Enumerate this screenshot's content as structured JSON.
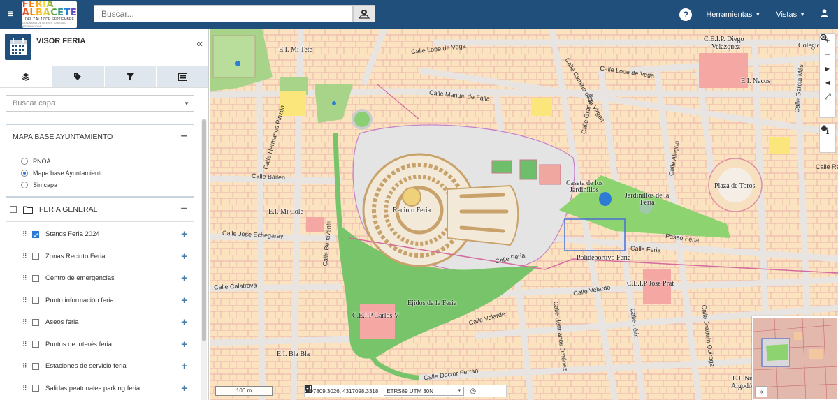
{
  "topbar": {
    "logo_title": "FERIA ALBACETE",
    "logo_dates": "DEL 7 AL 17 DE SEPTIEMBRE",
    "logo_tagline": "DECLARADA DE INTERÉS TURÍSTICO INTERNACIONAL",
    "search_placeholder": "Buscar...",
    "menu_tools": "Herramientas",
    "menu_views": "Vistas"
  },
  "sidebar": {
    "title": "VISOR FERIA",
    "capa_placeholder": "Buscar capa",
    "base_section": {
      "title": "MAPA BASE AYUNTAMIENTO",
      "options": [
        {
          "label": "PNOA",
          "selected": false
        },
        {
          "label": "Mapa base Ayuntamiento",
          "selected": true
        },
        {
          "label": "Sin capa",
          "selected": false
        }
      ]
    },
    "feria_section": {
      "title": "FERIA GENERAL",
      "layers": [
        {
          "label": "Stands Feria 2024",
          "checked": true
        },
        {
          "label": "Zonas Recinto Feria",
          "checked": false
        },
        {
          "label": "Centro de emergencias",
          "checked": false
        },
        {
          "label": "Punto información feria",
          "checked": false
        },
        {
          "label": "Aseos feria",
          "checked": false
        },
        {
          "label": "Puntos de interés feria",
          "checked": false
        },
        {
          "label": "Estaciones de servicio feria",
          "checked": false
        },
        {
          "label": "Salidas peatonales parking feria",
          "checked": false
        }
      ]
    }
  },
  "map": {
    "labels": {
      "mitete": "E.I. Mi Tete",
      "diego": "C.E.I.P. Diego",
      "velazquez": "Velazquez",
      "nacos": "E.I. Nacos",
      "micole": "E.I. Mi Cole",
      "recinto": "Recinto Feria",
      "caseta1": "Caseta de los",
      "caseta2": "Jardinillos",
      "jard1": "Jardinillos de la",
      "jard2": "Feria",
      "toros": "Plaza de Toros",
      "polideportivo": "Polideportivo Feria",
      "prat": "C.E.I.P Jose Prat",
      "ejidos": "Ejidos de la Feria",
      "carlos": "C.E.I.P Carlos V",
      "blabla": "E.I. Bla Bla",
      "nube": "E.I. Nube",
      "algodon": "Algodó",
      "colegio": "Colegio"
    },
    "streets": {
      "lope1": "Calle Lope de Vega",
      "lope2": "Calle Lope de Vega",
      "manuel": "Calle Manuel de Falla",
      "bailen": "Calle Bailén",
      "echegaray": "Calle José Echegaray",
      "calatrava": "Calle Calatrava",
      "feria1": "Calle Feria",
      "feria2": "Calle Feria",
      "paseo": "Paseo Feria",
      "velarde1": "Calle Velarde",
      "velarde2": "Calle Velarde",
      "doctor": "Calle Doctor Ferran",
      "pinzon": "Calle Hermanos Pinzón",
      "benavente": "Calle Benavente",
      "virgen": "Calle Camino de la Virgen",
      "granada": "Calle Granada",
      "alegria": "Calle Alegría",
      "raimu": "Calle Raimu",
      "jimenez": "Calle Hermanos Jiménez",
      "felipe": "Calle Félix",
      "quiroga": "Calle Joaquín Quiroga",
      "garcia": "Calle García Más"
    },
    "scale_text": "100 m",
    "coordinates": "597809.3026, 4317098.3318",
    "projection": "ETRS89 UTM 30N"
  }
}
